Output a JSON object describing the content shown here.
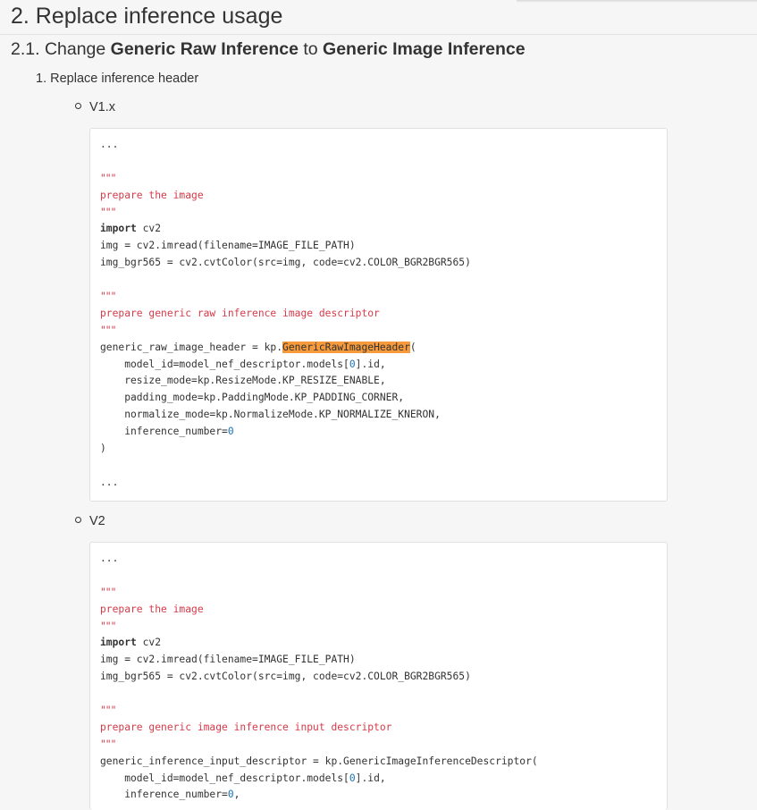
{
  "heading": {
    "section": "2. Replace inference usage",
    "subsection_prefix": "2.1. Change ",
    "subsection_from": "Generic Raw Inference",
    "subsection_mid": " to ",
    "subsection_to": "Generic Image Inference"
  },
  "steps": [
    {
      "label": "1. Replace inference header"
    }
  ],
  "versions": [
    {
      "label": "V1.x",
      "code": {
        "ellipsis_top": "...",
        "docstring_1": "prepare the image",
        "triple_quote": "\"\"\"",
        "import_kw": "import",
        "import_mod": " cv2",
        "line_imread": "img = cv2.imread(filename=IMAGE_FILE_PATH)",
        "line_cvt": "img_bgr565 = cv2.cvtColor(src=img, code=cv2.COLOR_BGR2BGR565)",
        "docstring_2": "prepare generic raw inference image descriptor",
        "assign_prefix": "generic_raw_image_header = kp.",
        "assign_class": "GenericRawImageHeader",
        "assign_open": "(",
        "arg_model_pre": "    model_id=model_nef_descriptor.models[",
        "arg_model_idx": "0",
        "arg_model_post": "].id,",
        "arg_resize": "    resize_mode=kp.ResizeMode.KP_RESIZE_ENABLE,",
        "arg_padding": "    padding_mode=kp.PaddingMode.KP_PADDING_CORNER,",
        "arg_normalize": "    normalize_mode=kp.NormalizeMode.KP_NORMALIZE_KNERON,",
        "arg_infnum_pre": "    inference_number=",
        "arg_infnum_val": "0",
        "close_paren": ")",
        "ellipsis_bottom": "..."
      }
    },
    {
      "label": "V2",
      "code": {
        "ellipsis_top": "...",
        "docstring_1": "prepare the image",
        "triple_quote": "\"\"\"",
        "import_kw": "import",
        "import_mod": " cv2",
        "line_imread": "img = cv2.imread(filename=IMAGE_FILE_PATH)",
        "line_cvt": "img_bgr565 = cv2.cvtColor(src=img, code=cv2.COLOR_BGR2BGR565)",
        "docstring_2": "prepare generic image inference input descriptor",
        "assign_line": "generic_inference_input_descriptor = kp.GenericImageInferenceDescriptor(",
        "arg_model_pre": "    model_id=model_nef_descriptor.models[",
        "arg_model_idx": "0",
        "arg_model_post": "].id,",
        "arg_infnum_pre": "    inference_number=",
        "arg_infnum_val": "0",
        "arg_infnum_post": ","
      }
    }
  ],
  "colors": {
    "background": "#f6f6f6",
    "code_background": "#ffffff",
    "string": "#d73a49",
    "number": "#1a73b5",
    "highlight": "#f79a3b"
  }
}
